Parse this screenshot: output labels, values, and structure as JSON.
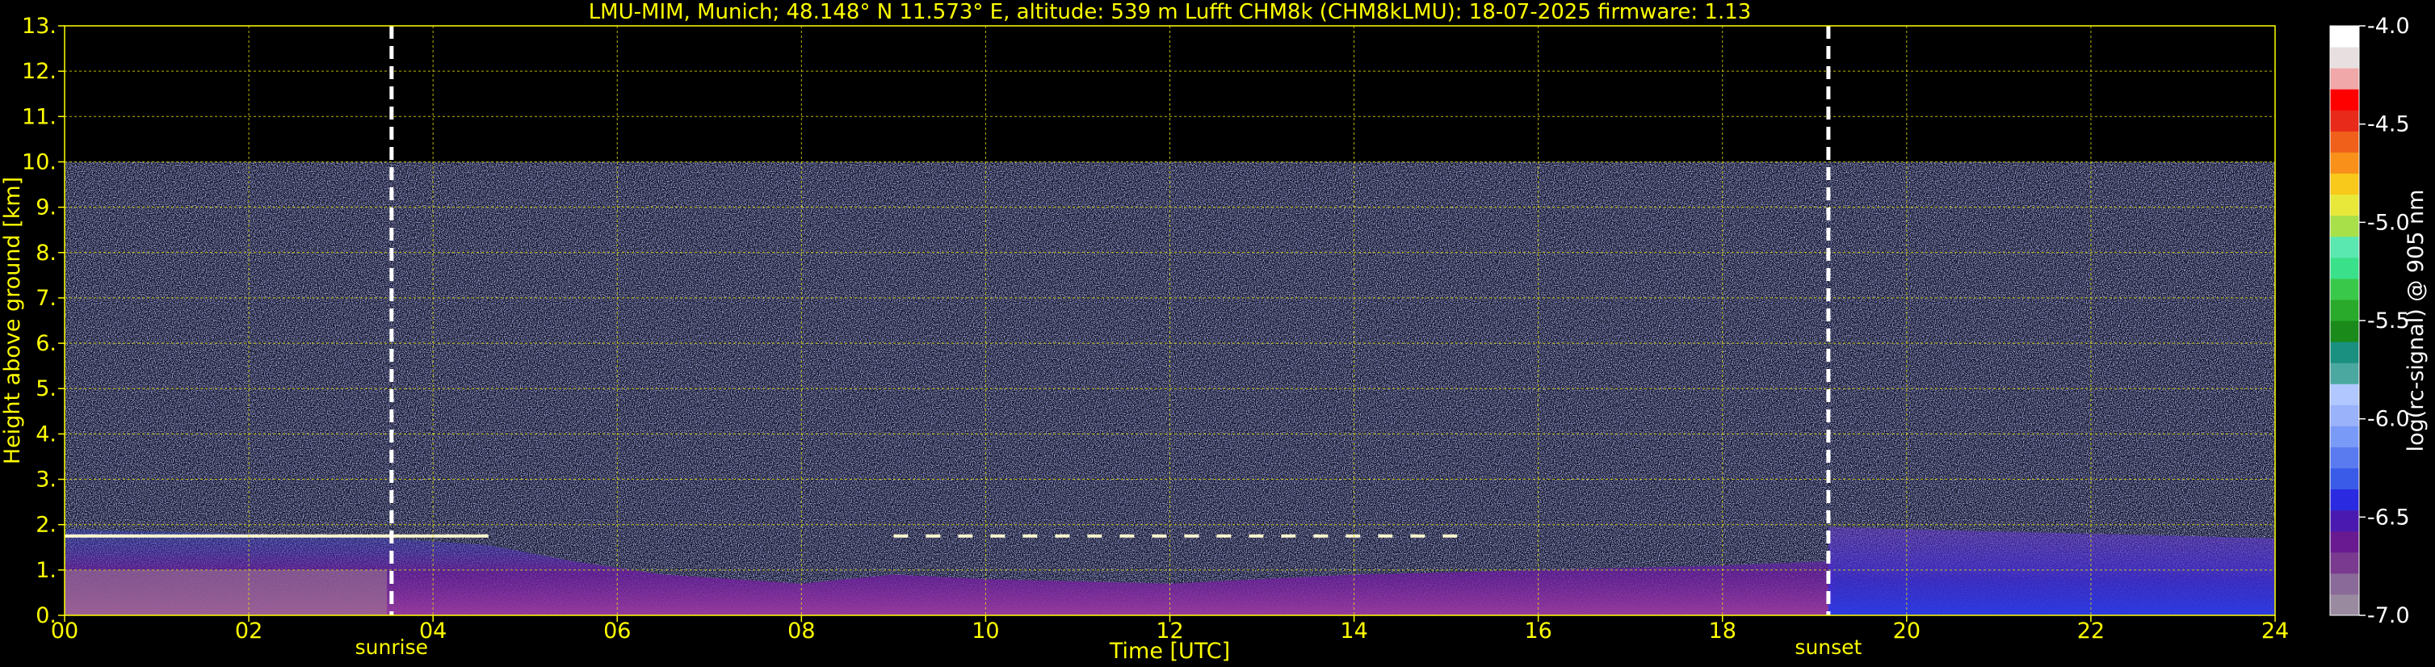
{
  "chart_data": {
    "type": "heatmap",
    "title": "LMU-MIM, Munich; 48.148° N 11.573° E, altitude: 539 m    Lufft CHM8k (CHM8kLMU): 18-07-2025    firmware: 1.13",
    "xlabel": "Time [UTC]",
    "ylabel": "Height above ground [km]",
    "xlim": [
      0,
      24
    ],
    "ylim": [
      0,
      13
    ],
    "x_ticks": [
      "00",
      "02",
      "04",
      "06",
      "08",
      "10",
      "12",
      "14",
      "16",
      "18",
      "20",
      "22",
      "24"
    ],
    "x_tick_values": [
      0,
      2,
      4,
      6,
      8,
      10,
      12,
      14,
      16,
      18,
      20,
      22,
      24
    ],
    "y_ticks": [
      "0.",
      "1.",
      "2.",
      "3.",
      "4.",
      "5.",
      "6.",
      "7.",
      "8.",
      "9.",
      "10.",
      "11.",
      "12.",
      "13."
    ],
    "y_tick_values": [
      0,
      1,
      2,
      3,
      4,
      5,
      6,
      7,
      8,
      9,
      10,
      11,
      12,
      13
    ],
    "grid": true,
    "data_top_km": 10,
    "events": [
      {
        "label": "sunrise",
        "x": 3.55
      },
      {
        "label": "sunset",
        "x": 19.15
      }
    ],
    "cloud_layers": [
      {
        "x_range": [
          0,
          4.6
        ],
        "height_km": 1.75
      },
      {
        "x_range": [
          9.0,
          15.2
        ],
        "height_km": 1.75
      }
    ],
    "colorbar": {
      "label": "log(rc-signal) @ 905 nm",
      "range": [
        -7.0,
        -4.0
      ],
      "ticks": [
        "-4.0",
        "-4.5",
        "-5.0",
        "-5.5",
        "-6.0",
        "-6.5",
        "-7.0"
      ],
      "tick_values": [
        -4.0,
        -4.5,
        -5.0,
        -5.5,
        -6.0,
        -6.5,
        -7.0
      ],
      "colors": [
        "#9a8aa0",
        "#8a6a98",
        "#7a3a90",
        "#6a1a90",
        "#4a1ab0",
        "#2a2ae0",
        "#3a5ae8",
        "#5a7af0",
        "#7a9af8",
        "#9ab2fa",
        "#b0c8ff",
        "#4aa8a0",
        "#1a9080",
        "#1a8a1a",
        "#2aaa2a",
        "#3ac84a",
        "#3ae08a",
        "#5ae8b0",
        "#a8e04a",
        "#e8e83a",
        "#f8c81a",
        "#f8901a",
        "#f0601a",
        "#e82a1a",
        "#ff0000",
        "#f0a8a8",
        "#e8e0e0",
        "#ffffff"
      ]
    }
  },
  "colors": {
    "text": "#ffff00",
    "grid": "#e6e600",
    "background": "#000000",
    "colorbar_text": "#ffffff",
    "event_line": "#ffffff"
  }
}
